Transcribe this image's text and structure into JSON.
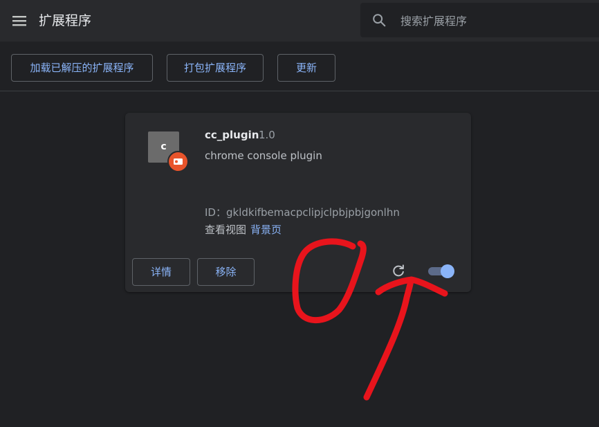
{
  "header": {
    "title": "扩展程序",
    "search_placeholder": "搜索扩展程序"
  },
  "toolbar": {
    "load_unpacked_label": "加载已解压的扩展程序",
    "pack_label": "打包扩展程序",
    "update_label": "更新"
  },
  "extension": {
    "icon_letter": "c",
    "name": "cc_plugin",
    "version": "1.0",
    "description": "chrome console plugin",
    "id_label": "ID：",
    "id_value": "gkldkifbemacpclipjclpbjpbjgonlhn",
    "views_label": "查看视图",
    "views_link": "背景页",
    "details_label": "详情",
    "remove_label": "移除",
    "enabled": true
  },
  "colors": {
    "accent": "#8ab4f8",
    "background": "#202124",
    "surface": "#292a2d",
    "badge": "#e8542b",
    "annotation": "#e8141c"
  }
}
